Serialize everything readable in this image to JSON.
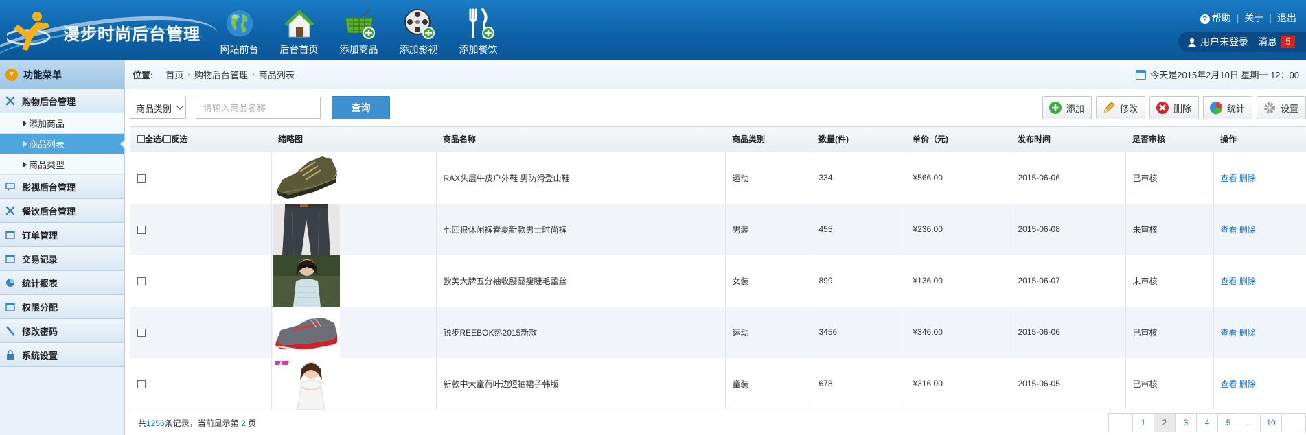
{
  "app": {
    "title": "漫步时尚后台管理"
  },
  "nav": [
    {
      "label": "网站前台",
      "icon": "globe-icon"
    },
    {
      "label": "后台首页",
      "icon": "home-icon"
    },
    {
      "label": "添加商品",
      "icon": "add-cart-icon"
    },
    {
      "label": "添加影视",
      "icon": "add-film-icon"
    },
    {
      "label": "添加餐饮",
      "icon": "add-food-icon"
    }
  ],
  "topright": {
    "help": "帮助",
    "about": "关于",
    "logout": "退出"
  },
  "userbar": {
    "user": "用户未登录",
    "messages": "消息",
    "message_count": "5"
  },
  "sidebar": {
    "title": "功能菜单",
    "sections": [
      {
        "label": "购物后台管理",
        "icon": "tools-icon",
        "children": [
          "添加商品",
          "商品列表",
          "商品类型"
        ]
      },
      {
        "label": "影视后台管理",
        "icon": "chat-icon"
      },
      {
        "label": "餐饮后台管理",
        "icon": "tools-icon"
      },
      {
        "label": "订单管理",
        "icon": "calendar-icon"
      },
      {
        "label": "交易记录",
        "icon": "calendar-icon"
      },
      {
        "label": "统计报表",
        "icon": "pie-chart-icon"
      },
      {
        "label": "权限分配",
        "icon": "calendar-icon"
      },
      {
        "label": "修改密码",
        "icon": "pen-icon"
      },
      {
        "label": "系统设置",
        "icon": "lock-icon"
      }
    ],
    "active_child": "商品列表"
  },
  "breadcrumb": {
    "label": "位置:",
    "items": [
      "首页",
      "购物后台管理",
      "商品列表"
    ],
    "date": "今天是2015年2月10日 星期一 12：00"
  },
  "toolbar": {
    "category_select": "商品类别",
    "search_placeholder": "请输入商品名称",
    "query_label": "查询",
    "actions": [
      {
        "label": "添加",
        "icon": "plus-icon",
        "color": "#3bab3f"
      },
      {
        "label": "修改",
        "icon": "pencil-icon",
        "color": "#e29a1c"
      },
      {
        "label": "删除",
        "icon": "delete-icon",
        "color": "#d8262c"
      },
      {
        "label": "统计",
        "icon": "pie-chart-icon",
        "color": "#3b8bd9"
      },
      {
        "label": "设置",
        "icon": "gear-icon",
        "color": "#9a9a9a"
      }
    ]
  },
  "table": {
    "headers": {
      "select_all": "全选/",
      "invert": "反选",
      "thumb": "缩略图",
      "name": "商品名称",
      "category": "商品类别",
      "qty": "数量(件)",
      "price": "单价（元)",
      "date": "发布时间",
      "audit": "是否审核",
      "ops": "操作"
    },
    "rows": [
      {
        "name": "RAX头层牛皮户外鞋 男防滑登山鞋",
        "category": "运动",
        "qty": "334",
        "price": "¥566.00",
        "date": "2015-06-06",
        "audit": "已审核",
        "thumb": "hiking-shoe"
      },
      {
        "name": "七匹狼休闲裤春夏新款男士时尚裤",
        "category": "男装",
        "qty": "455",
        "price": "¥236.00",
        "date": "2015-06-08",
        "audit": "未审核",
        "thumb": "trousers"
      },
      {
        "name": "欧美大牌五分袖收腰显瘦睫毛蕾丝",
        "category": "女装",
        "qty": "899",
        "price": "¥136.00",
        "date": "2015-06-07",
        "audit": "未审核",
        "thumb": "lace-top"
      },
      {
        "name": "锐步REEBOK热2015新款",
        "category": "运动",
        "qty": "3456",
        "price": "¥346.00",
        "date": "2015-06-06",
        "audit": "已审核",
        "thumb": "sneaker"
      },
      {
        "name": "新款中大童荷叶边短袖裙子韩版",
        "category": "童装",
        "qty": "678",
        "price": "¥316.00",
        "date": "2015-06-05",
        "audit": "已审核",
        "thumb": "girl-dress"
      }
    ],
    "view_label": "查看",
    "delete_label": "删除"
  },
  "footer": {
    "prefix": "共",
    "total": "1256",
    "mid": "条记录，当前显示第 ",
    "page": "2",
    "suffix": " 页"
  },
  "pager": [
    "",
    "1",
    "2",
    "3",
    "4",
    "5",
    "...",
    "10",
    ""
  ],
  "pager_current": "2"
}
